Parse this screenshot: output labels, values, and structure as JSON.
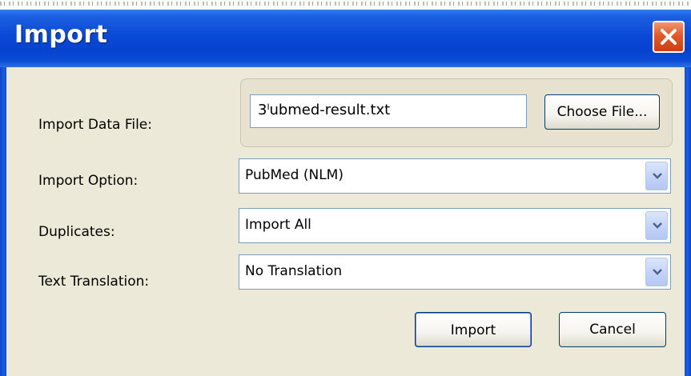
{
  "window": {
    "title": "Import",
    "close_icon": "close-icon"
  },
  "form": {
    "data_file_label": "Import Data File:",
    "data_file_value": "3ˡubmed-result.txt",
    "choose_file_label": "Choose File...",
    "import_option_label": "Import Option:",
    "import_option_value": "PubMed (NLM)",
    "duplicates_label": "Duplicates:",
    "duplicates_value": "Import All",
    "text_translation_label": "Text Translation:",
    "text_translation_value": "No Translation"
  },
  "buttons": {
    "import_label": "Import",
    "cancel_label": "Cancel"
  },
  "colors": {
    "titlebar": "#0a49d6",
    "close_button": "#e25a2a",
    "dialog_background": "#ece9d8"
  }
}
